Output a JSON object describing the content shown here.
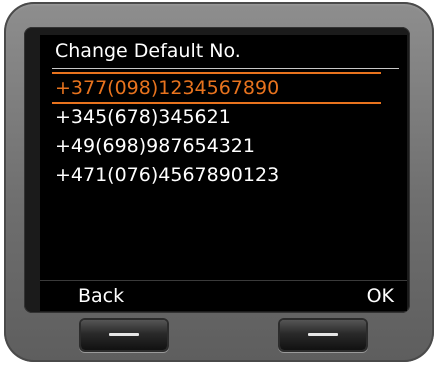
{
  "screen": {
    "title": "Change Default No.",
    "numbers": [
      "+377(098)1234567890",
      "+345(678)345621",
      "+49(698)987654321",
      "+471(076)4567890123"
    ],
    "selected_index": 0
  },
  "softkeys": {
    "left_label": "Back",
    "right_label": "OK"
  },
  "colors": {
    "highlight": "#e8731e",
    "screen_background": "#000000",
    "text": "#ffffff"
  }
}
